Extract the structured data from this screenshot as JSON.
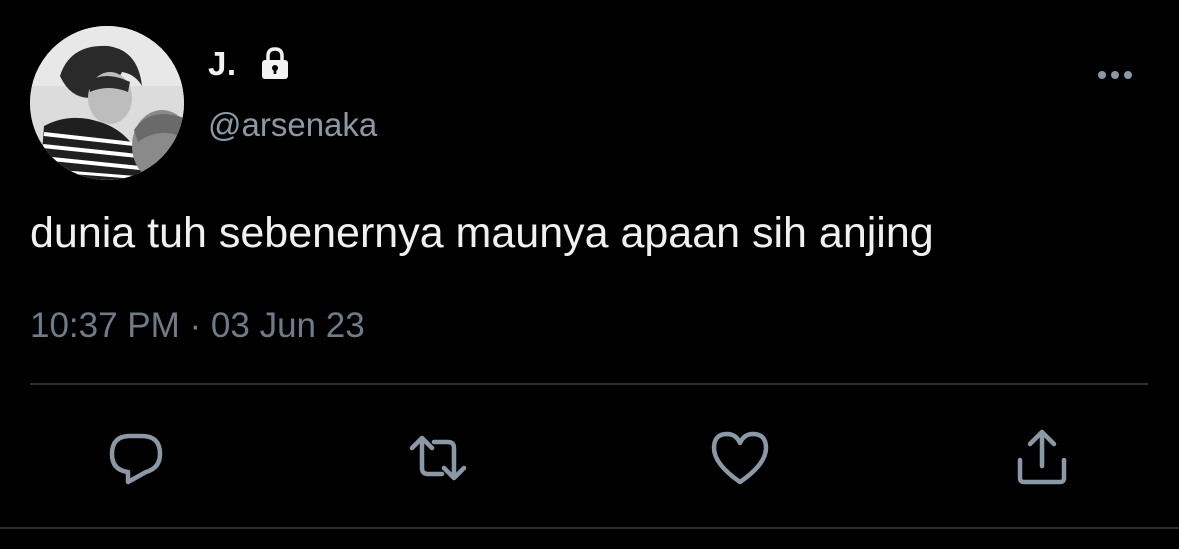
{
  "tweet": {
    "display_name": "J.",
    "handle": "@arsenaka",
    "text": "dunia tuh sebenernya maunya apaan sih anjing",
    "timestamp": "10:37 PM · 03 Jun 23"
  },
  "icons": {
    "lock": "lock-icon",
    "more": "more-horizontal-icon",
    "reply": "reply-icon",
    "retweet": "retweet-icon",
    "like": "heart-icon",
    "share": "share-icon"
  },
  "colors": {
    "background": "#000000",
    "text_primary": "#f0f0f0",
    "text_secondary": "#8b98a5",
    "icon": "#8b98a5",
    "divider": "#2b3036"
  }
}
